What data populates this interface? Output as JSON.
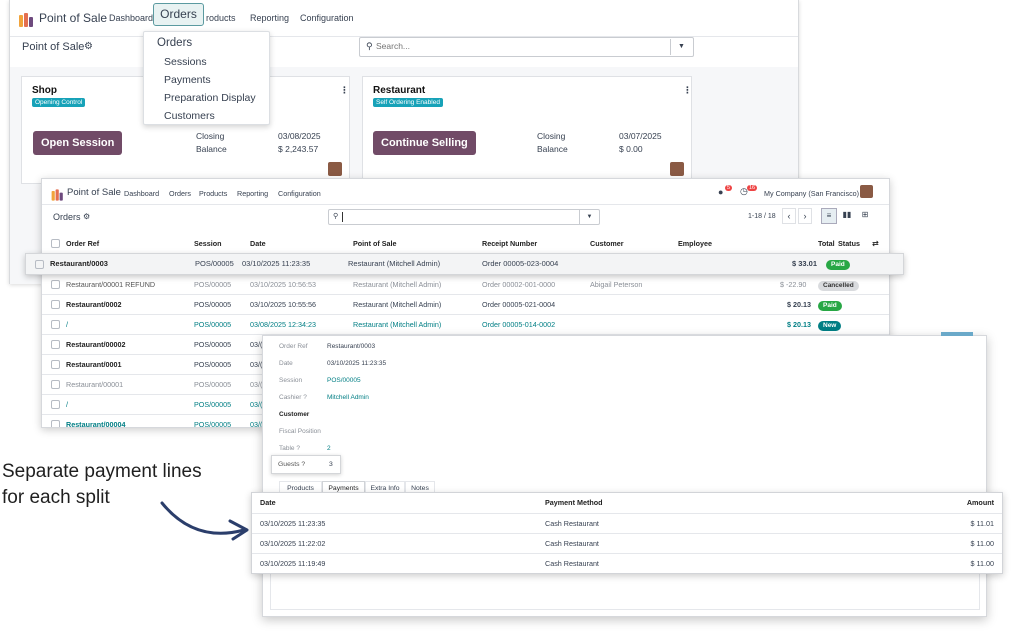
{
  "bg_nav": {
    "app": "Point of Sale",
    "dashboard": "Dashboard",
    "products_partial": "roducts",
    "reporting": "Reporting",
    "configuration": "Configuration",
    "title": "Point of Sale"
  },
  "search": {
    "placeholder": "Search..."
  },
  "orders_highlight": "Orders",
  "dropdown": {
    "items": [
      "Orders",
      "Sessions",
      "Payments",
      "Preparation Display",
      "Customers"
    ]
  },
  "cards": {
    "shop": {
      "name": "Shop",
      "badge": "Opening Control",
      "button": "Open Session",
      "closing_label": "Closing",
      "closing_date": "03/08/2025",
      "balance_label": "Balance",
      "balance": "$ 2,243.57"
    },
    "restaurant": {
      "name": "Restaurant",
      "badge": "Self Ordering Enabled",
      "button": "Continue Selling",
      "closing_label": "Closing",
      "closing_date": "03/07/2025",
      "balance_label": "Balance",
      "balance": "$ 0.00"
    }
  },
  "win2": {
    "nav": {
      "app": "Point of Sale",
      "dashboard": "Dashboard",
      "orders": "Orders",
      "products": "Products",
      "reporting": "Reporting",
      "configuration": "Configuration",
      "company": "My Company (San Francisco)",
      "msg_count": "5",
      "activity_count": "16"
    },
    "title": "Orders",
    "pager": "1-18 / 18",
    "columns": [
      "Order Ref",
      "Session",
      "Date",
      "Point of Sale",
      "Receipt Number",
      "Customer",
      "Employee",
      "Total",
      "Status"
    ],
    "highlight_row": {
      "ref": "Restaurant/0003",
      "session": "POS/00005",
      "date": "03/10/2025 11:23:35",
      "pos": "Restaurant (Mitchell Admin)",
      "receipt": "Order 00005-023-0004",
      "total": "$ 33.01",
      "status": "Paid"
    },
    "rows": [
      {
        "ref": "Restaurant/00001 REFUND",
        "session": "POS/00005",
        "date": "03/10/2025 10:56:53",
        "pos": "Restaurant (Mitchell Admin)",
        "receipt": "Order 00002-001-0000",
        "customer": "Abigail Peterson",
        "total": "$ -22.90",
        "status": "Cancelled"
      },
      {
        "ref": "Restaurant/0002",
        "session": "POS/00005",
        "date": "03/10/2025 10:55:56",
        "pos": "Restaurant (Mitchell Admin)",
        "receipt": "Order 00005-021-0004",
        "customer": "",
        "total": "$ 20.13",
        "status": "Paid"
      },
      {
        "ref": "/",
        "session": "POS/00005",
        "date": "03/08/2025 12:34:23",
        "pos": "Restaurant (Mitchell Admin)",
        "receipt": "Order 00005-014-0002",
        "customer": "",
        "total": "$ 20.13",
        "status": "New"
      },
      {
        "ref": "Restaurant/00002",
        "session": "POS/00005",
        "date": "03/("
      },
      {
        "ref": "Restaurant/0001",
        "session": "POS/00005",
        "date": "03/("
      },
      {
        "ref": "Restaurant/00001",
        "session": "POS/00005",
        "date": "03/("
      },
      {
        "ref": "/",
        "session": "POS/00005",
        "date": "03/("
      },
      {
        "ref": "Restaurant/00004",
        "session": "POS/00005",
        "date": "03/("
      }
    ]
  },
  "form": {
    "fields": [
      {
        "label": "Order Ref",
        "value": "Restaurant/0003"
      },
      {
        "label": "Date",
        "value": "03/10/2025 11:23:35"
      },
      {
        "label": "Session",
        "value": "POS/00005"
      },
      {
        "label": "Cashier ?",
        "value": "Mitchell Admin"
      },
      {
        "label": "Customer",
        "value": ""
      },
      {
        "label": "Fiscal Position",
        "value": ""
      },
      {
        "label": "Table ?",
        "value": "2"
      }
    ],
    "guests_label": "Guests ?",
    "guests_value": "3",
    "tabs": [
      "Products",
      "Payments",
      "Extra Info",
      "Notes"
    ]
  },
  "payments": {
    "columns": [
      "Date",
      "Payment Method",
      "Amount"
    ],
    "rows": [
      {
        "date": "03/10/2025 11:23:35",
        "method": "Cash Restaurant",
        "amount": "$ 11.01"
      },
      {
        "date": "03/10/2025 11:22:02",
        "method": "Cash Restaurant",
        "amount": "$ 11.00"
      },
      {
        "date": "03/10/2025 11:19:49",
        "method": "Cash Restaurant",
        "amount": "$ 11.00"
      }
    ]
  },
  "annotation": {
    "line1": "Separate payment lines",
    "line2": "for each split"
  },
  "colors": {
    "purple": "#714B67",
    "teal": "#017e84",
    "paid": "#28a745",
    "badge_teal": "#17a2b8"
  }
}
